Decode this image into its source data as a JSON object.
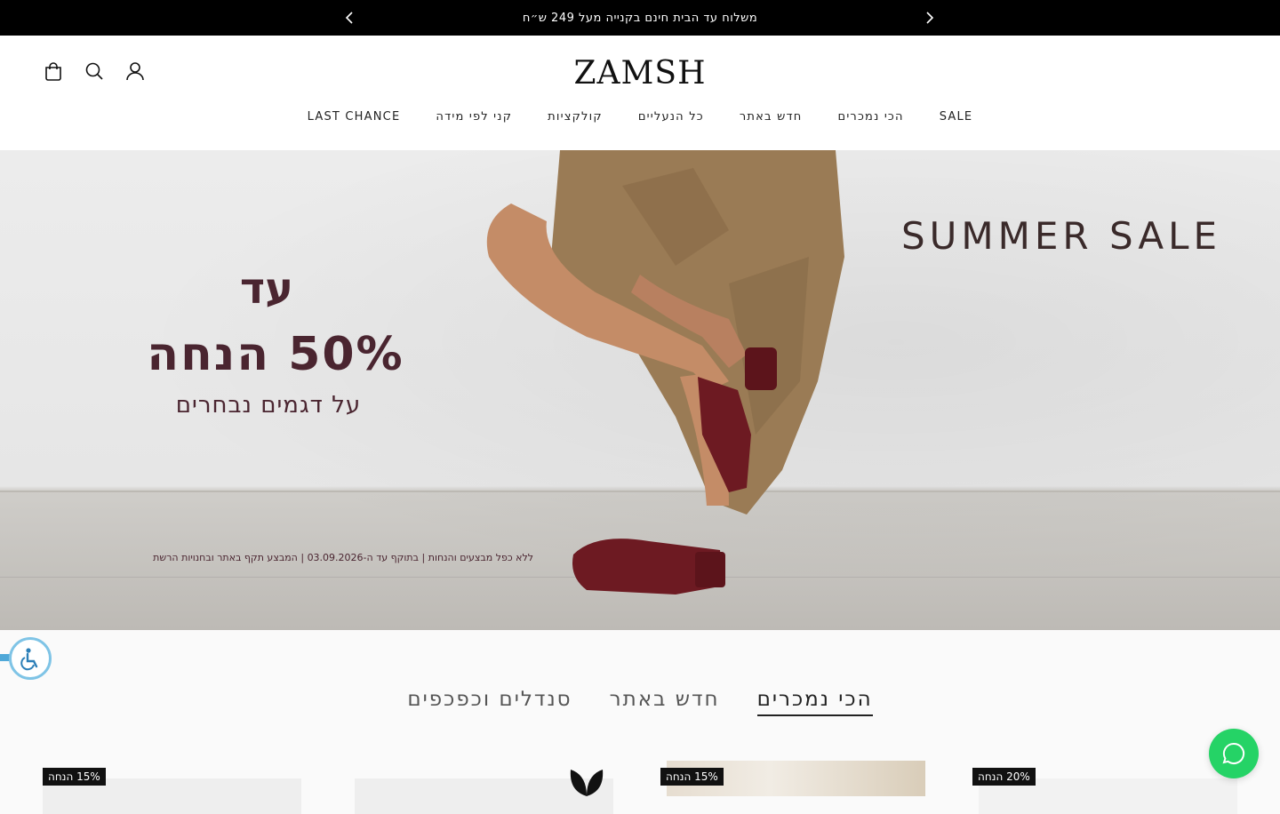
{
  "announcement": {
    "text": "משלוח עד הבית חינם בקנייה מעל 249 ש״ח"
  },
  "brand": {
    "logo_text": "ZAMSH"
  },
  "nav": {
    "items": [
      {
        "label": "SALE"
      },
      {
        "label": "הכי נמכרים"
      },
      {
        "label": "חדש באתר"
      },
      {
        "label": "כל הנעליים"
      },
      {
        "label": "קולקציות"
      },
      {
        "label": "קני לפי מידה"
      },
      {
        "label": "LAST CHANCE"
      }
    ]
  },
  "hero": {
    "headline": "SUMMER SALE",
    "promo_line1": "עד",
    "promo_line2": "50% הנחה",
    "promo_line3": "על דגמים נבחרים",
    "fine_print": "ללא כפל מבצעים והנחות | בתוקף עד ה-03.09.2026 | המבצע תקף באתר ובחנויות הרשת"
  },
  "tabs": [
    {
      "label": "הכי נמכרים",
      "active": true
    },
    {
      "label": "חדש באתר",
      "active": false
    },
    {
      "label": "סנדלים וכפכפים",
      "active": false
    }
  ],
  "products": [
    {
      "badge": "15% הנחה"
    },
    {
      "badge": ""
    },
    {
      "badge": "15% הנחה"
    },
    {
      "badge": "20% הנחה"
    }
  ],
  "colors": {
    "accent": "#000000",
    "chat": "#25d366",
    "promo_text": "#4a2530",
    "access_border": "#7fc4e6"
  },
  "icons": [
    "chevron-left-icon",
    "chevron-right-icon",
    "bag-icon",
    "search-icon",
    "user-icon",
    "accessibility-icon",
    "chat-icon",
    "leaf-icon"
  ]
}
